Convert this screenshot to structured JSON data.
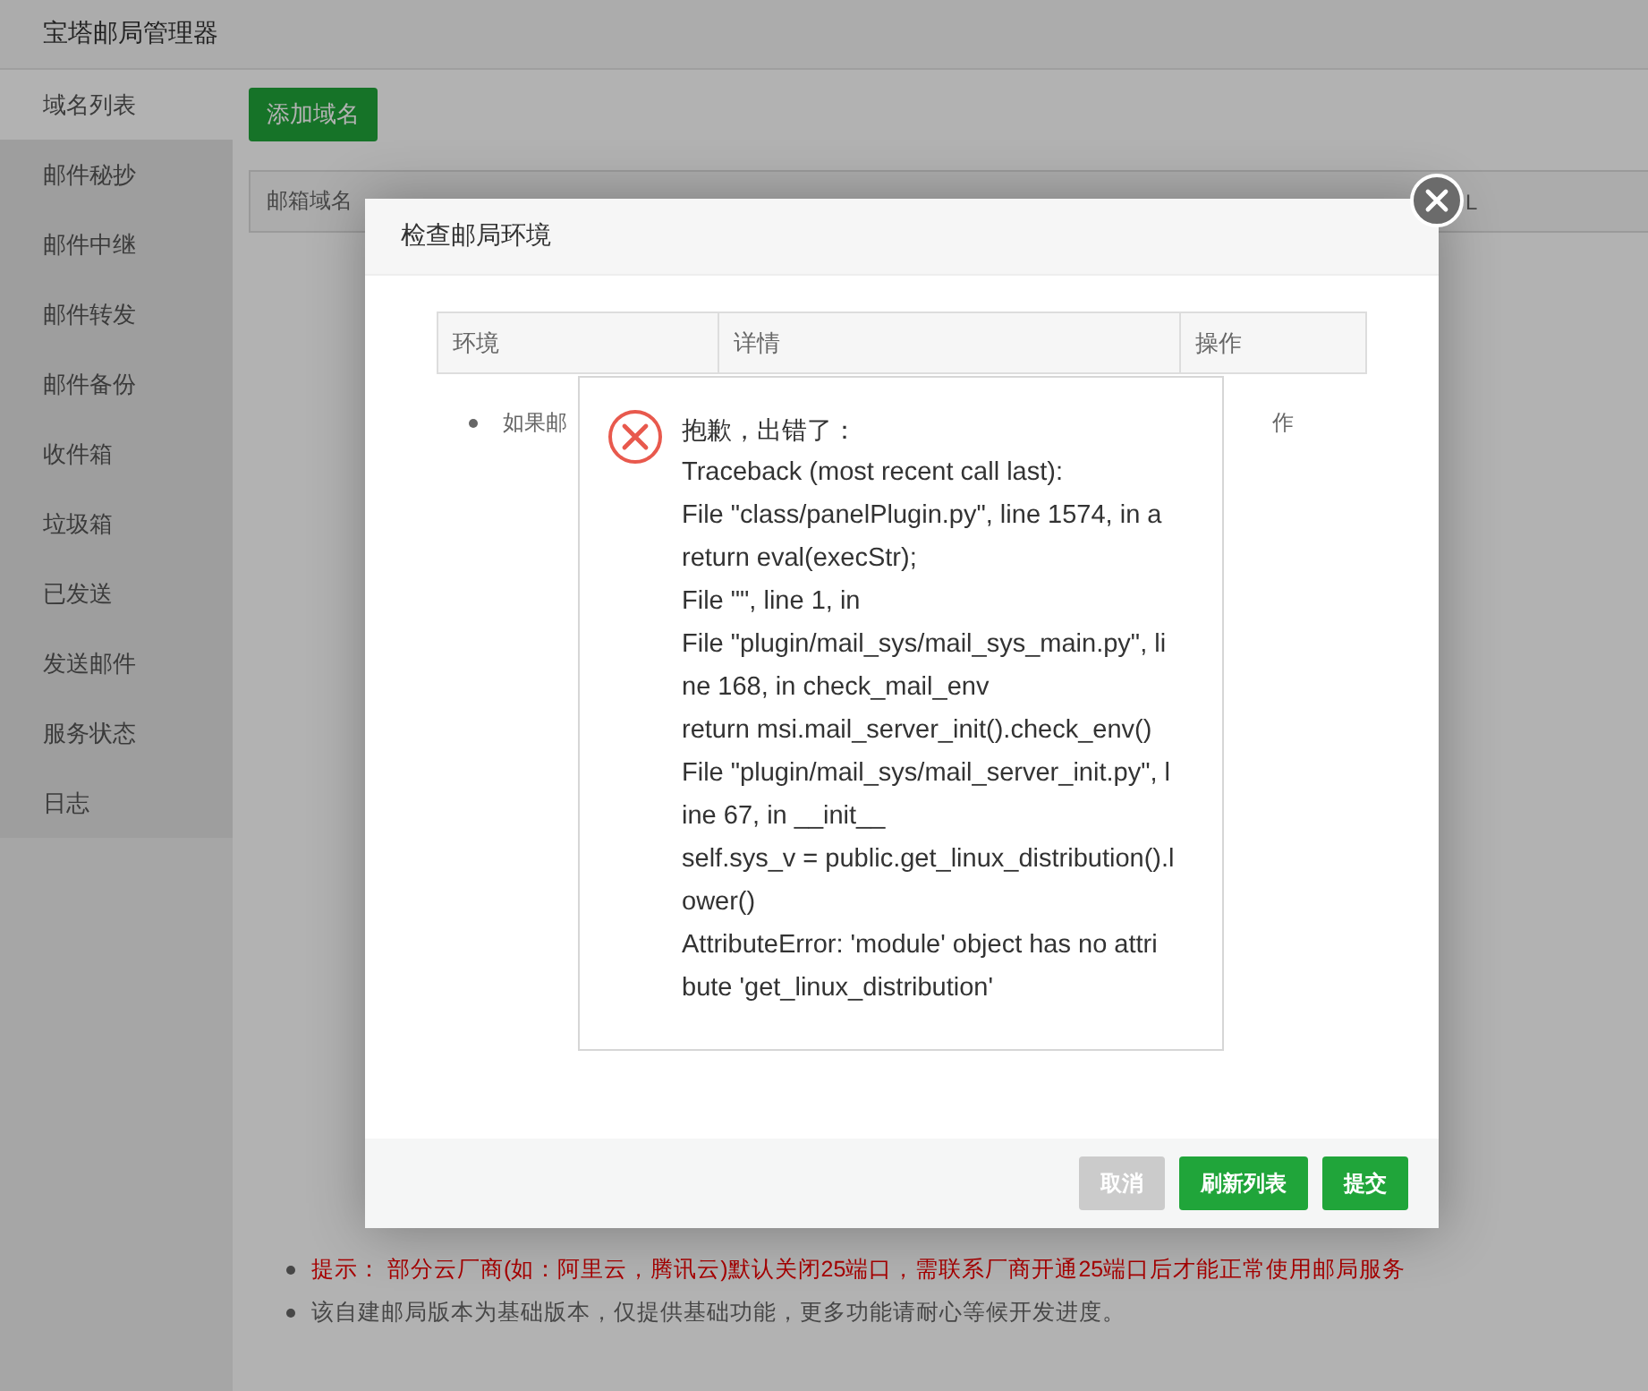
{
  "app": {
    "title": "宝塔邮局管理器"
  },
  "sidebar": {
    "items": [
      {
        "label": "域名列表",
        "selected": true
      },
      {
        "label": "邮件秘抄",
        "selected": false
      },
      {
        "label": "邮件中继",
        "selected": false
      },
      {
        "label": "邮件转发",
        "selected": false
      },
      {
        "label": "邮件备份",
        "selected": false
      },
      {
        "label": "收件箱",
        "selected": false
      },
      {
        "label": "垃圾箱",
        "selected": false
      },
      {
        "label": "已发送",
        "selected": false
      },
      {
        "label": "发送邮件",
        "selected": false
      },
      {
        "label": "服务状态",
        "selected": false
      },
      {
        "label": "日志",
        "selected": false
      }
    ]
  },
  "toolbar": {
    "add_button": "添加域名"
  },
  "table": {
    "columns": [
      "邮箱域名",
      "L"
    ]
  },
  "notes": [
    {
      "kind": "warning",
      "text": "提示： 部分云厂商(如：阿里云，腾讯云)默认关闭25端口，需联系厂商开通25端口后才能正常使用邮局服务"
    },
    {
      "kind": "info",
      "text": "该自建邮局版本为基础版本，仅提供基础功能，更多功能请耐心等候开发进度。"
    }
  ],
  "dialog": {
    "title": "检查邮局环境",
    "columns": [
      "环境",
      "详情",
      "操作"
    ],
    "notes": [
      {
        "text": "如果邮",
        "tail": "作"
      }
    ],
    "buttons": [
      {
        "label": "取消",
        "kind": "cancel"
      },
      {
        "label": "刷新列表",
        "kind": "primary"
      },
      {
        "label": "提交",
        "kind": "primary"
      }
    ]
  },
  "error_popup": {
    "title": "抱歉，出错了：",
    "lines": [
      "Traceback (most recent call last):",
      "File \"class/panelPlugin.py\", line 1574, in a",
      "return eval(execStr);",
      "File \"\", line 1, in",
      "File \"plugin/mail_sys/mail_sys_main.py\", li",
      "ne 168, in check_mail_env",
      "return msi.mail_server_init().check_env()",
      "File \"plugin/mail_sys/mail_server_init.py\", l",
      "ine 67, in __init__",
      "self.sys_v = public.get_linux_distribution().l",
      "ower()",
      "AttributeError: 'module' object has no attri",
      "bute 'get_linux_distribution'"
    ]
  }
}
